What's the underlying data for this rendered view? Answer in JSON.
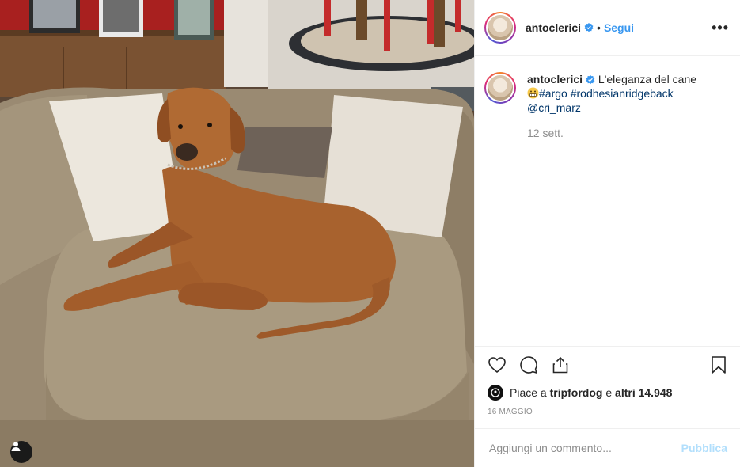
{
  "post": {
    "photo_alt": "",
    "author": {
      "username": "antoclerici",
      "verified": true,
      "follow_label": "Segui",
      "separator": "•",
      "more_label": "•••"
    },
    "caption": {
      "username": "antoclerici",
      "text": "L'eleganza del cane",
      "emoji": "grimacing-face",
      "hashtags": [
        "#argo",
        "#rodhesianridgeback"
      ],
      "mention": "@cri_marz",
      "time_ago": "12 sett."
    },
    "likes": {
      "prefix": "Piace a ",
      "user": "tripfordog",
      "middle": " e ",
      "others": "altri 14.948"
    },
    "date": "16 MAGGIO",
    "comment": {
      "placeholder": "Aggiungi un commento...",
      "value": "",
      "publish_label": "Pubblica"
    },
    "icons": {
      "like": "heart-icon",
      "comment": "comment-icon",
      "share": "share-icon",
      "save": "bookmark-icon",
      "tags": "user-tag-icon"
    },
    "colors": {
      "link_blue": "#3897f0",
      "hashtag": "#003569",
      "muted": "#8e8e8e",
      "publish_disabled": "#b2dffc"
    }
  }
}
